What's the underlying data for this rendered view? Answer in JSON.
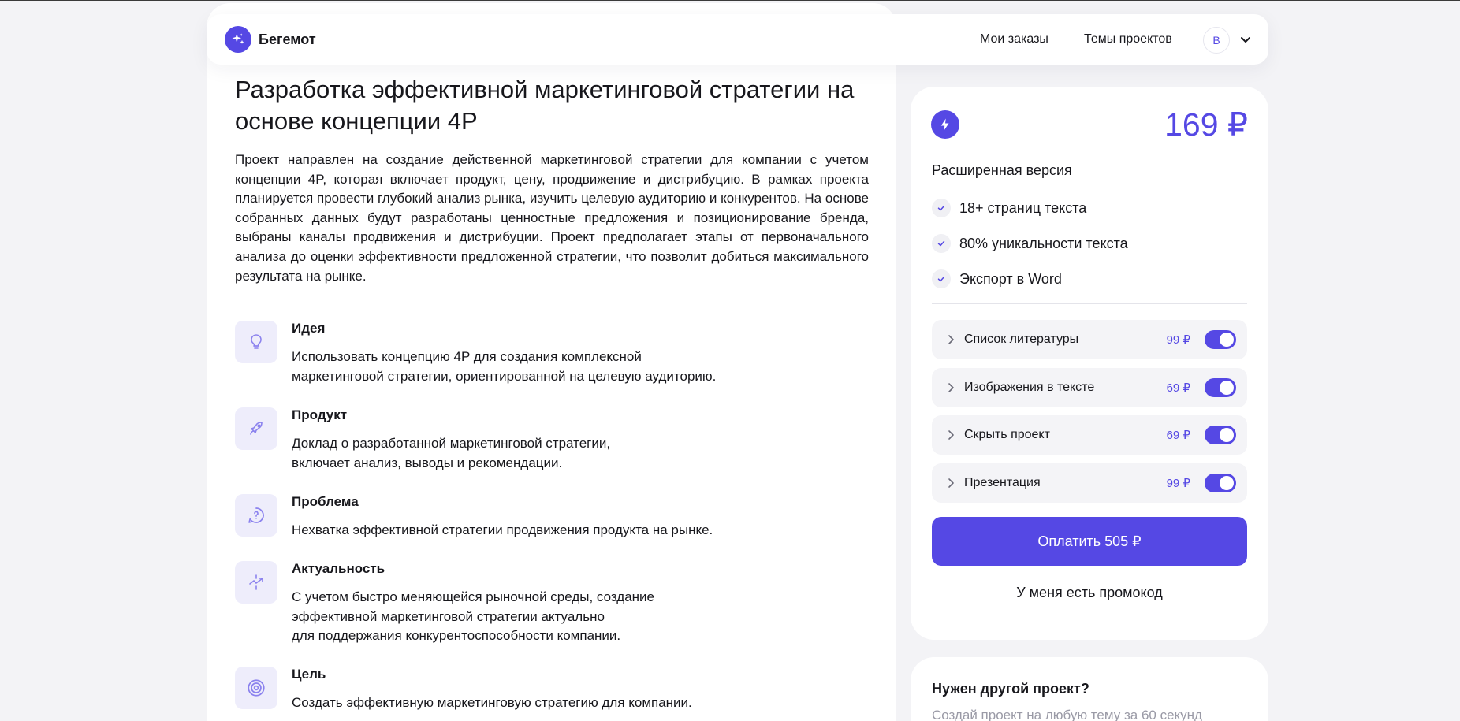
{
  "header": {
    "logo_text": "Бегемот",
    "nav": {
      "orders": "Мои заказы",
      "themes": "Темы проектов"
    },
    "avatar_letter": "В"
  },
  "project": {
    "title": "Разработка эффективной маркетинговой стратегии на основе концепции 4P",
    "description": "Проект направлен на создание действенной маркетинговой стратегии для компании с учетом концепции 4P, которая включает продукт, цену, продвижение и дистрибуцию. В рамках проекта планируется провести глубокий анализ рынка, изучить целевую аудиторию и конкурентов. На основе собранных данных будут разработаны ценностные предложения и позиционирование бренда, выбраны каналы продвижения и дистрибуции. Проект предполагает этапы от первоначального анализа до оценки эффективности предложенной стратегии, что позволит добиться максимального результата на рынке.",
    "features": [
      {
        "icon": "lightbulb-icon",
        "title": "Идея",
        "text": "Использовать концепцию 4P для создания комплексной\nмаркетинговой стратегии, ориентированной на целевую аудиторию."
      },
      {
        "icon": "rocket-icon",
        "title": "Продукт",
        "text": "Доклад о разработанной маркетинговой стратегии,\nвключает анализ, выводы и рекомендации."
      },
      {
        "icon": "question-bubble-icon",
        "title": "Проблема",
        "text": "Нехватка эффективной стратегии продвижения продукта на рынке."
      },
      {
        "icon": "arrows-exchange-icon",
        "title": "Актуальность",
        "text": "С учетом быстро меняющейся рыночной среды, создание\nэффективной маркетинговой стратегии актуально\nдля поддержания конкурентоспособности компании."
      },
      {
        "icon": "target-icon",
        "title": "Цель",
        "text": "Создать эффективную маркетинговую стратегию для компании."
      }
    ]
  },
  "pricing": {
    "price": "169 ₽",
    "plan_name": "Расширенная версия",
    "plan_features": [
      "18+ страниц текста",
      "80% уникальности текста",
      "Экспорт в Word"
    ],
    "addons": [
      {
        "label": "Список литературы",
        "price": "99 ₽",
        "enabled": true
      },
      {
        "label": "Изображения в тексте",
        "price": "69 ₽",
        "enabled": true
      },
      {
        "label": "Скрыть проект",
        "price": "69 ₽",
        "enabled": true
      },
      {
        "label": "Презентация",
        "price": "99 ₽",
        "enabled": true
      }
    ],
    "pay_label": "Оплатить  505 ₽",
    "promo_label": "У меня есть промокод"
  },
  "other_project": {
    "title": "Нужен другой проект?",
    "subtitle": "Создай проект на любую тему за 60 секунд"
  },
  "colors": {
    "accent": "#5548e4",
    "icon_bg": "#eeedfb",
    "page_bg": "#f3f3f6"
  }
}
